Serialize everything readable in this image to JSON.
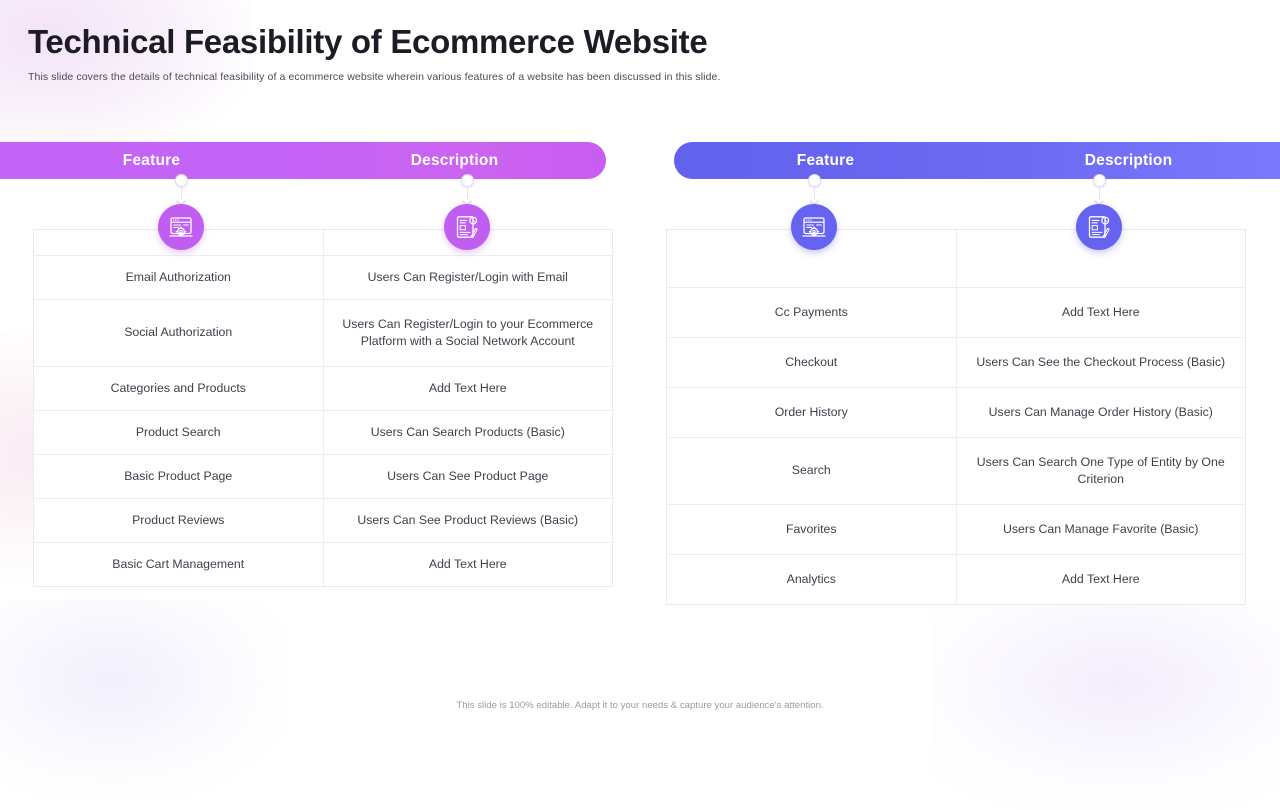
{
  "header": {
    "title": "Technical Feasibility of Ecommerce Website",
    "subtitle": "This slide covers the details of technical feasibility of a ecommerce website wherein various  features of a website has been discussed in this slide."
  },
  "colors": {
    "left_bar_start": "#c265f7",
    "left_bar_end": "#c95cf2",
    "right_bar_start": "#6262ee",
    "right_bar_end": "#7a78fb",
    "left_icon_badge": "#c05ef2",
    "right_icon_badge": "#6563ef",
    "table_border": "#ededf1",
    "body_text": "#3f3f4c",
    "title_text": "#1c1c26",
    "footer_text": "#9a9aa6"
  },
  "left_table": {
    "headers": {
      "feature": "Feature",
      "description": "Description"
    },
    "icons": {
      "feature": "browser-gear-icon",
      "description": "document-report-icon"
    },
    "rows": [
      {
        "feature": "Email Authorization",
        "description": "Users Can Register/Login with Email"
      },
      {
        "feature": "Social Authorization",
        "description": "Users Can Register/Login to your Ecommerce Platform with a Social Network Account"
      },
      {
        "feature": "Categories and Products",
        "description": "Add Text Here"
      },
      {
        "feature": "Product Search",
        "description": "Users Can Search Products (Basic)"
      },
      {
        "feature": "Basic Product Page",
        "description": "Users Can See Product Page"
      },
      {
        "feature": "Product Reviews",
        "description": "Users Can See Product Reviews (Basic)"
      },
      {
        "feature": "Basic Cart Management",
        "description": "Add Text Here"
      }
    ]
  },
  "right_table": {
    "headers": {
      "feature": "Feature",
      "description": "Description"
    },
    "icons": {
      "feature": "browser-gear-icon",
      "description": "document-report-icon"
    },
    "rows": [
      {
        "feature": "Cc Payments",
        "description": "Add Text Here"
      },
      {
        "feature": "Checkout",
        "description": "Users Can See the Checkout Process (Basic)"
      },
      {
        "feature": "Order History",
        "description": "Users Can Manage Order History (Basic)"
      },
      {
        "feature": "Search",
        "description": "Users Can Search One Type of Entity by One Criterion"
      },
      {
        "feature": "Favorites",
        "description": "Users Can Manage Favorite (Basic)"
      },
      {
        "feature": "Analytics",
        "description": "Add Text Here"
      }
    ]
  },
  "footer": {
    "note": "This slide is 100% editable. Adapt it to your needs & capture your audience's attention."
  }
}
